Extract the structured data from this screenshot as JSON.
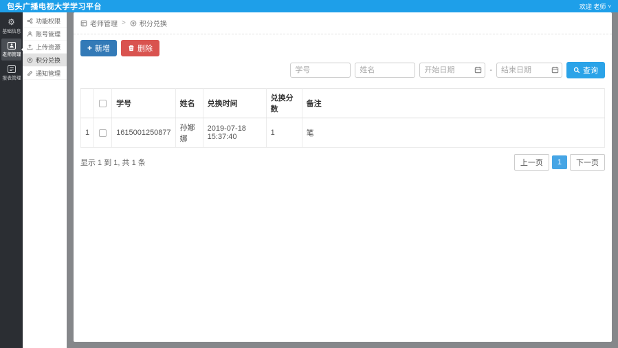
{
  "topbar": {
    "title": "包头广播电视大学学习平台",
    "user": "欢迎 老师",
    "caret": "˅"
  },
  "rail": {
    "items": [
      {
        "label": "基础信息",
        "icon": "gears-icon",
        "selected": false
      },
      {
        "label": "老师管理",
        "icon": "teacher-icon",
        "selected": true
      },
      {
        "label": "报表管理",
        "icon": "report-icon",
        "selected": false
      }
    ]
  },
  "submenu": {
    "items": [
      {
        "label": "功能权限",
        "icon": "permission-icon",
        "selected": false
      },
      {
        "label": "账号管理",
        "icon": "account-icon",
        "selected": false
      },
      {
        "label": "上传资源",
        "icon": "upload-icon",
        "selected": false
      },
      {
        "label": "积分兑换",
        "icon": "points-icon",
        "selected": true
      },
      {
        "label": "通知管理",
        "icon": "notice-icon",
        "selected": false
      }
    ]
  },
  "breadcrumb": {
    "parent": "老师管理",
    "separator": ">",
    "current": "积分兑换"
  },
  "toolbar": {
    "add_label": "新增",
    "delete_label": "删除"
  },
  "filters": {
    "student_id_placeholder": "学号",
    "name_placeholder": "姓名",
    "start_date_placeholder": "开始日期",
    "date_separator": "-",
    "end_date_placeholder": "结束日期",
    "search_label": "查询"
  },
  "table": {
    "columns": [
      "学号",
      "姓名",
      "兑换时间",
      "兑换分数",
      "备注"
    ],
    "rows": [
      {
        "index": "1",
        "student_id": "1615001250877",
        "name": "孙娜娜",
        "exchange_time": "2019-07-18 15:37:40",
        "points": "1",
        "remark": "笔"
      }
    ]
  },
  "footer": {
    "summary": "显示 1 到 1, 共 1 条",
    "prev_label": "上一页",
    "page": "1",
    "next_label": "下一页"
  },
  "colors": {
    "topbar_blue": "#1e9fe9",
    "primary_blue": "#337ab7",
    "danger_red": "#d9534f",
    "search_blue": "#2ba3e8",
    "active_page_blue": "#46a5e5",
    "rail_dark": "#2b2e33"
  }
}
